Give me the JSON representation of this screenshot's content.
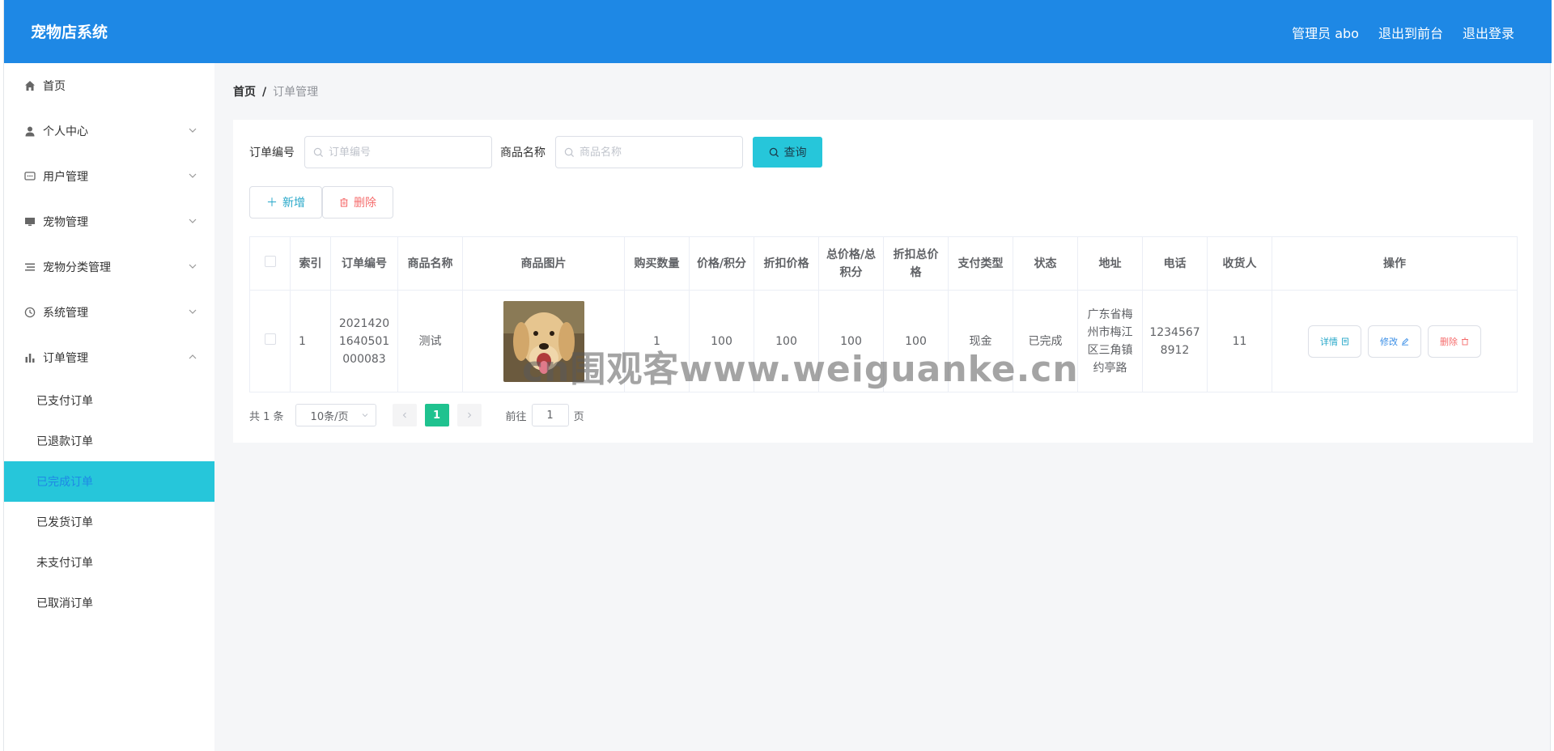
{
  "header": {
    "brand": "宠物店系统",
    "admin_label": "管理员 abo",
    "back_front": "退出到前台",
    "logout": "退出登录"
  },
  "sidebar": {
    "items": [
      {
        "label": "首页",
        "icon": "home-icon"
      },
      {
        "label": "个人中心",
        "icon": "user-icon"
      },
      {
        "label": "用户管理",
        "icon": "chat-icon"
      },
      {
        "label": "宠物管理",
        "icon": "monitor-icon"
      },
      {
        "label": "宠物分类管理",
        "icon": "list-icon"
      },
      {
        "label": "系统管理",
        "icon": "clock-icon"
      },
      {
        "label": "订单管理",
        "icon": "chart-icon"
      }
    ],
    "order_sub": [
      {
        "label": "已支付订单"
      },
      {
        "label": "已退款订单"
      },
      {
        "label": "已完成订单"
      },
      {
        "label": "已发货订单"
      },
      {
        "label": "未支付订单"
      },
      {
        "label": "已取消订单"
      }
    ]
  },
  "breadcrumb": {
    "home": "首页",
    "sep": "/",
    "current": "订单管理"
  },
  "search": {
    "order_no_label": "订单编号",
    "order_no_placeholder": "订单编号",
    "product_label": "商品名称",
    "product_placeholder": "商品名称",
    "query_button": "查询"
  },
  "actions": {
    "add": "新增",
    "delete": "删除"
  },
  "table": {
    "headers": [
      "索引",
      "订单编号",
      "商品名称",
      "商品图片",
      "购买数量",
      "价格/积分",
      "折扣价格",
      "总价格/总积分",
      "折扣总价格",
      "支付类型",
      "状态",
      "地址",
      "电话",
      "收货人",
      "操作"
    ],
    "rows": [
      {
        "index": "1",
        "order_no": "20214201640501000083",
        "product": "测试",
        "qty": "1",
        "price": "100",
        "discount_price": "100",
        "total": "100",
        "discount_total": "100",
        "pay_type": "现金",
        "status": "已完成",
        "address": "广东省梅州市梅江区三角镇约亭路",
        "phone": "12345678912",
        "receiver": "11"
      }
    ],
    "ops": {
      "detail": "详情",
      "edit": "修改",
      "remove": "删除"
    }
  },
  "pager": {
    "total": "共 1 条",
    "size": "10条/页",
    "page": "1",
    "goto": "前往",
    "goto_value": "1",
    "page_unit": "页"
  },
  "watermark": "cn围观客www.weiguanke.cn",
  "colors": {
    "header": "#1e88e5",
    "accent": "#26c6da",
    "page_active": "#1fc28f"
  }
}
